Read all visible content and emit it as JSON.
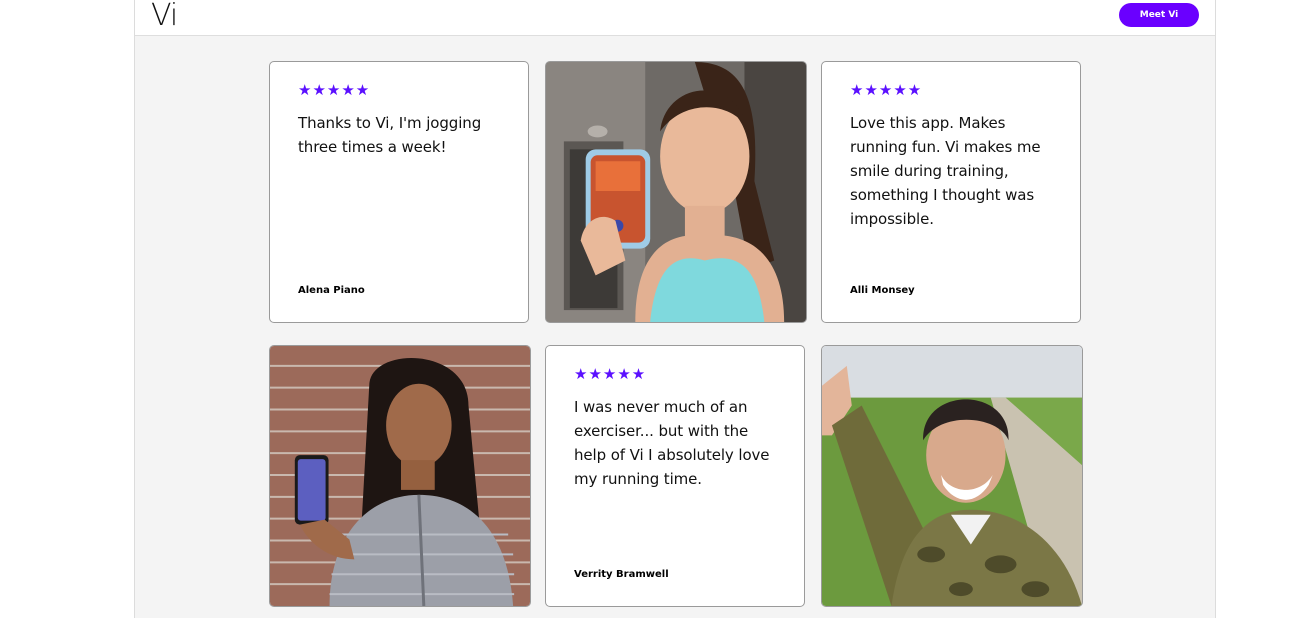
{
  "header": {
    "logo": "Vi",
    "cta_label": "Meet Vi"
  },
  "testimonials": [
    {
      "stars": "★★★★★",
      "text": "Thanks to Vi, I'm jogging three times a week!",
      "author": "Alena Piano"
    },
    {
      "stars": "★★★★★",
      "text": "Love this app. Makes running fun. Vi makes me smile during training, something I thought was impossible.",
      "author": "Alli Monsey"
    },
    {
      "stars": "★★★★★",
      "text": "I was never much of an exerciser... but with the help of Vi I absolutely love my running time.",
      "author": "Verrity Bramwell"
    }
  ],
  "colors": {
    "accent": "#6a00ff",
    "star": "#5b10ff",
    "page_bg": "#f4f4f4"
  }
}
